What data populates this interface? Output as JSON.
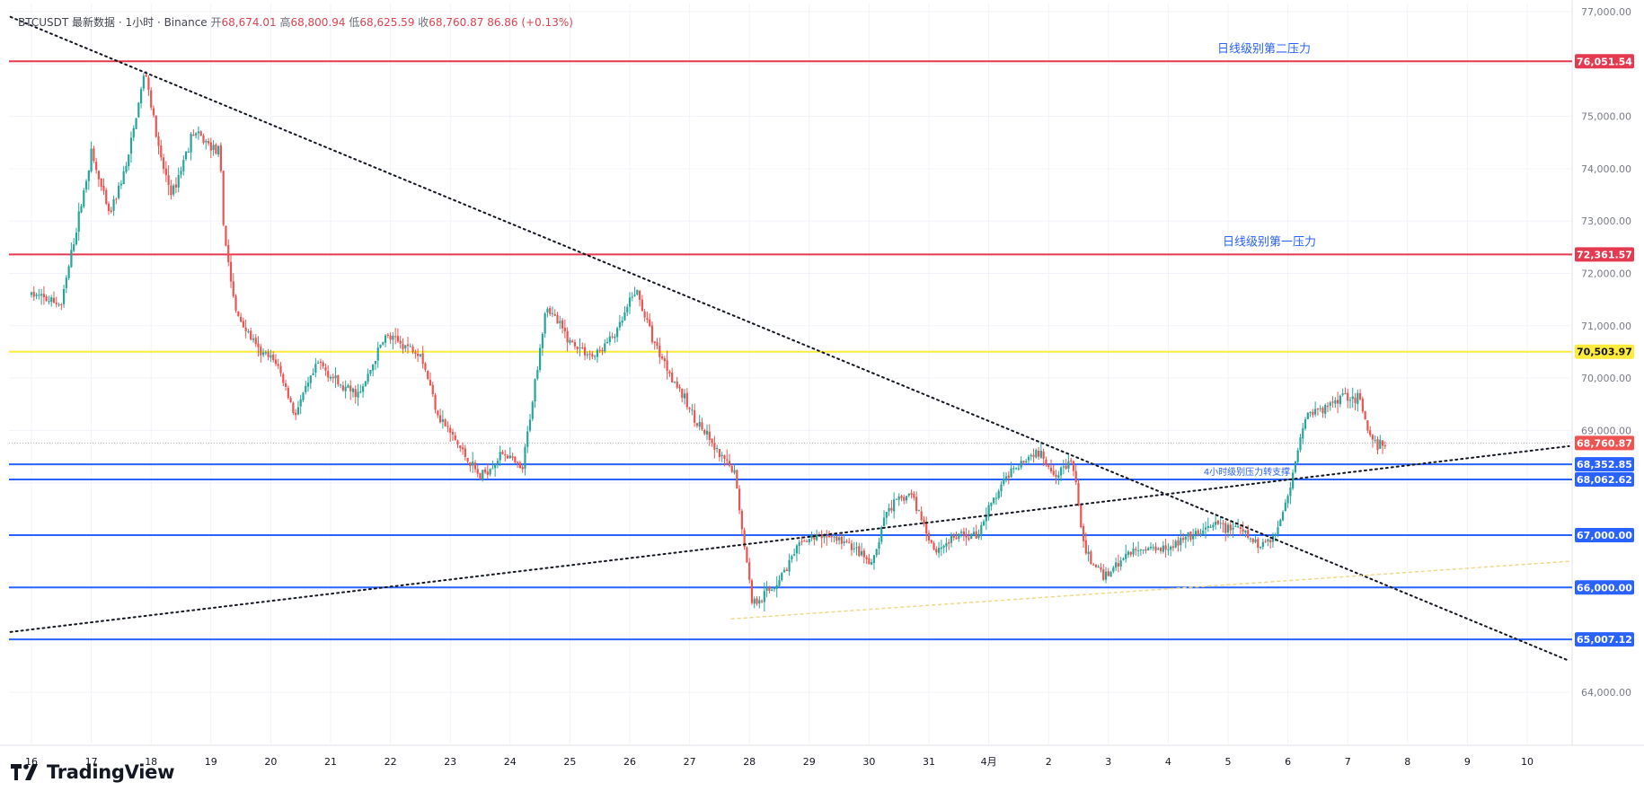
{
  "header": {
    "symbol": "BTCUSDT",
    "desc": "最新数据 · 1小时 · Binance",
    "open_label": "开",
    "open": "68,674.01",
    "high_label": "高",
    "high": "68,800.94",
    "low_label": "低",
    "low": "68,625.59",
    "close_label": "收",
    "close": "68,760.87",
    "change": "86.86 (+0.13%)"
  },
  "brand": "TradingView",
  "colors": {
    "up": "#26a69a",
    "down": "#ef5350",
    "red_line": "#e53950",
    "blue_line": "#2962ff",
    "yellow_line": "#ffeb3b",
    "grid": "#f0f3fa",
    "text": "#131722",
    "axis_text": "#787b86"
  },
  "chart_data": {
    "type": "candlestick",
    "symbol": "BTCUSDT",
    "interval": "1小时",
    "y_range": [
      64000,
      77000
    ],
    "y_ticks": [
      64000,
      65000,
      66000,
      67000,
      68000,
      69000,
      70000,
      71000,
      72000,
      73000,
      74000,
      75000,
      76000,
      77000
    ],
    "y_tick_labels": [
      "64,000.00",
      "65,000.00",
      "66,000.00",
      "67,000.00",
      "68,000.00",
      "69,000.00",
      "70,000.00",
      "71,000.00",
      "72,000.00",
      "73,000.00",
      "74,000.00",
      "75,000.00",
      "76,000.00",
      "77,000.00"
    ],
    "x_labels": [
      "16",
      "17",
      "18",
      "19",
      "20",
      "21",
      "22",
      "23",
      "24",
      "25",
      "26",
      "27",
      "28",
      "29",
      "30",
      "31",
      "4月",
      "2",
      "3",
      "4",
      "5",
      "6",
      "7",
      "8",
      "9",
      "10"
    ],
    "price_path": [
      [
        0,
        71600
      ],
      [
        0.5,
        71400
      ],
      [
        1.0,
        74300
      ],
      [
        1.3,
        73100
      ],
      [
        1.6,
        74100
      ],
      [
        1.9,
        75900
      ],
      [
        2.15,
        74200
      ],
      [
        2.35,
        73500
      ],
      [
        2.7,
        74700
      ],
      [
        3.15,
        74300
      ],
      [
        3.2,
        73000
      ],
      [
        3.4,
        71300
      ],
      [
        3.8,
        70500
      ],
      [
        4.1,
        70300
      ],
      [
        4.4,
        69300
      ],
      [
        4.8,
        70300
      ],
      [
        5.2,
        69800
      ],
      [
        5.5,
        69700
      ],
      [
        5.9,
        70800
      ],
      [
        6.5,
        70500
      ],
      [
        6.8,
        69300
      ],
      [
        7.2,
        68600
      ],
      [
        7.5,
        68100
      ],
      [
        7.9,
        68600
      ],
      [
        8.2,
        68200
      ],
      [
        8.6,
        71400
      ],
      [
        9.0,
        70700
      ],
      [
        9.4,
        70400
      ],
      [
        9.8,
        70900
      ],
      [
        10.1,
        71700
      ],
      [
        10.4,
        70700
      ],
      [
        11.0,
        69400
      ],
      [
        11.5,
        68500
      ],
      [
        11.75,
        68200
      ],
      [
        12.05,
        65700
      ],
      [
        12.4,
        66000
      ],
      [
        12.9,
        66900
      ],
      [
        13.3,
        67000
      ],
      [
        13.7,
        66800
      ],
      [
        14.05,
        66400
      ],
      [
        14.3,
        67500
      ],
      [
        14.7,
        67800
      ],
      [
        15.1,
        66700
      ],
      [
        15.5,
        67000
      ],
      [
        15.8,
        67000
      ],
      [
        16.0,
        67500
      ],
      [
        16.4,
        68300
      ],
      [
        16.8,
        68600
      ],
      [
        17.1,
        68200
      ],
      [
        17.4,
        68400
      ],
      [
        17.6,
        66700
      ],
      [
        17.9,
        66200
      ],
      [
        18.4,
        66700
      ],
      [
        19.0,
        66800
      ],
      [
        19.5,
        67000
      ],
      [
        19.8,
        67200
      ],
      [
        20.2,
        67100
      ],
      [
        20.5,
        66800
      ],
      [
        20.8,
        67000
      ],
      [
        21.0,
        67800
      ],
      [
        21.3,
        69300
      ],
      [
        21.6,
        69400
      ],
      [
        21.9,
        69700
      ],
      [
        22.2,
        69600
      ],
      [
        22.35,
        68900
      ],
      [
        22.5,
        68700
      ],
      [
        22.65,
        68761
      ]
    ],
    "horizontal_levels": [
      {
        "price": 76051.54,
        "label": "76,051.54",
        "color": "#e53950",
        "annotation": "日线级别第二压力"
      },
      {
        "price": 72361.57,
        "label": "72,361.57",
        "color": "#e53950",
        "annotation": "日线级别第一压力"
      },
      {
        "price": 70503.97,
        "label": "70,503.97",
        "color": "#ffeb3b"
      },
      {
        "price": 68352.85,
        "label": "68,352.85",
        "color": "#2962ff",
        "annotation": "4小时级别压力转支撑"
      },
      {
        "price": 68062.62,
        "label": "68,062.62",
        "color": "#2962ff"
      },
      {
        "price": 67000.0,
        "label": "67,000.00",
        "color": "#2962ff"
      },
      {
        "price": 66000.0,
        "label": "66,000.00",
        "color": "#2962ff"
      },
      {
        "price": 65007.12,
        "label": "65,007.12",
        "color": "#2962ff"
      }
    ],
    "current_price": {
      "price": 68760.87,
      "label": "68,760.87",
      "color": "#ef5350"
    },
    "trendlines": [
      {
        "kind": "resistance",
        "style": "dotted",
        "color": "#131722",
        "points": [
          [
            -0.35,
            76900
          ],
          [
            25.7,
            64600
          ]
        ]
      },
      {
        "kind": "support",
        "style": "dotted",
        "color": "#131722",
        "points": [
          [
            -0.35,
            65150
          ],
          [
            25.7,
            68700
          ]
        ]
      },
      {
        "kind": "support",
        "style": "dotted",
        "color": "#f0d98c",
        "points": [
          [
            11.7,
            65400
          ],
          [
            25.7,
            66500
          ]
        ]
      }
    ]
  }
}
